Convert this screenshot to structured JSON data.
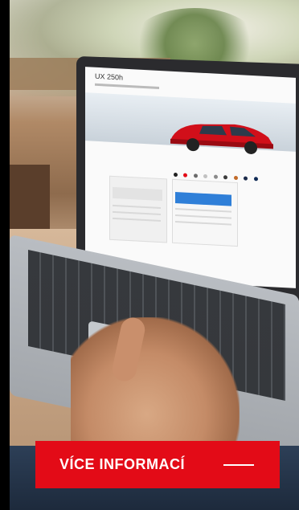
{
  "cta": {
    "label": "VÍCE INFORMACÍ",
    "color": "#e30b17",
    "icon": "dash-line-icon"
  },
  "screen": {
    "title": "UX 250h"
  },
  "colors": {
    "swatches": [
      "#222222",
      "#e30b17",
      "#6b6b6b",
      "#c2c2c2",
      "#8a8a8a",
      "#3b3b3b",
      "#c26b2a",
      "#1c2b4a",
      "#0f2a55"
    ]
  }
}
